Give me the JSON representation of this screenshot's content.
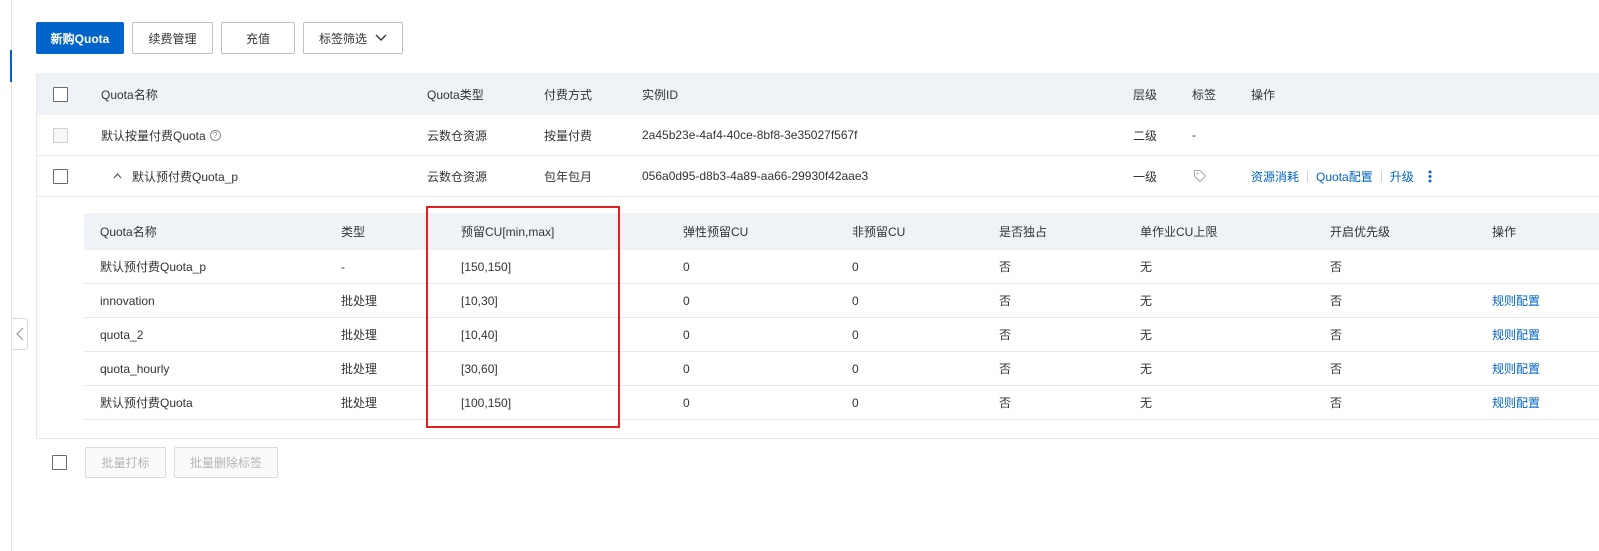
{
  "toolbar": {
    "buy_label": "新购Quota",
    "renew_label": "续费管理",
    "recharge_label": "充值",
    "tag_filter_label": "标签筛选"
  },
  "table": {
    "columns": {
      "name": "Quota名称",
      "type": "Quota类型",
      "billing": "付费方式",
      "instance": "实例ID",
      "level": "层级",
      "tag": "标签",
      "ops": "操作"
    },
    "rows": [
      {
        "name": "默认按量付费Quota",
        "help": "?",
        "type": "云数仓资源",
        "billing": "按量付费",
        "instance": "2a45b23e-4af4-40ce-8bf8-3e35027f567f",
        "level": "二级",
        "tag": "-"
      },
      {
        "name": "默认预付费Quota_p",
        "type": "云数仓资源",
        "billing": "包年包月",
        "instance": "056a0d95-d8b3-4a89-aa66-29930f42aae3",
        "level": "一级",
        "ops": [
          "资源消耗",
          "Quota配置",
          "升级"
        ]
      }
    ]
  },
  "subtable": {
    "columns": {
      "name": "Quota名称",
      "type": "类型",
      "reserved": "预留CU[min,max]",
      "elastic": "弹性预留CU",
      "nonreserved": "非预留CU",
      "exclusive": "是否独占",
      "job_limit": "单作业CU上限",
      "priority": "开启优先级",
      "ops": "操作"
    },
    "rows": [
      {
        "name": "默认预付费Quota_p",
        "type": "-",
        "reserved": "[150,150]",
        "elastic": "0",
        "nonreserved": "0",
        "exclusive": "否",
        "job_limit": "无",
        "priority": "否",
        "op": ""
      },
      {
        "name": "innovation",
        "type": "批处理",
        "reserved": "[10,30]",
        "elastic": "0",
        "nonreserved": "0",
        "exclusive": "否",
        "job_limit": "无",
        "priority": "否",
        "op": "规则配置"
      },
      {
        "name": "quota_2",
        "type": "批处理",
        "reserved": "[10,40]",
        "elastic": "0",
        "nonreserved": "0",
        "exclusive": "否",
        "job_limit": "无",
        "priority": "否",
        "op": "规则配置"
      },
      {
        "name": "quota_hourly",
        "type": "批处理",
        "reserved": "[30,60]",
        "elastic": "0",
        "nonreserved": "0",
        "exclusive": "否",
        "job_limit": "无",
        "priority": "否",
        "op": "规则配置"
      },
      {
        "name": "默认预付费Quota",
        "type": "批处理",
        "reserved": "[100,150]",
        "elastic": "0",
        "nonreserved": "0",
        "exclusive": "否",
        "job_limit": "无",
        "priority": "否",
        "op": "规则配置"
      }
    ]
  },
  "footer": {
    "batch_tag_label": "批量打标",
    "batch_untag_label": "批量删除标签"
  },
  "colors": {
    "primary": "#0064c8",
    "header_bg": "#eff3f8",
    "highlight": "#e0201d"
  }
}
